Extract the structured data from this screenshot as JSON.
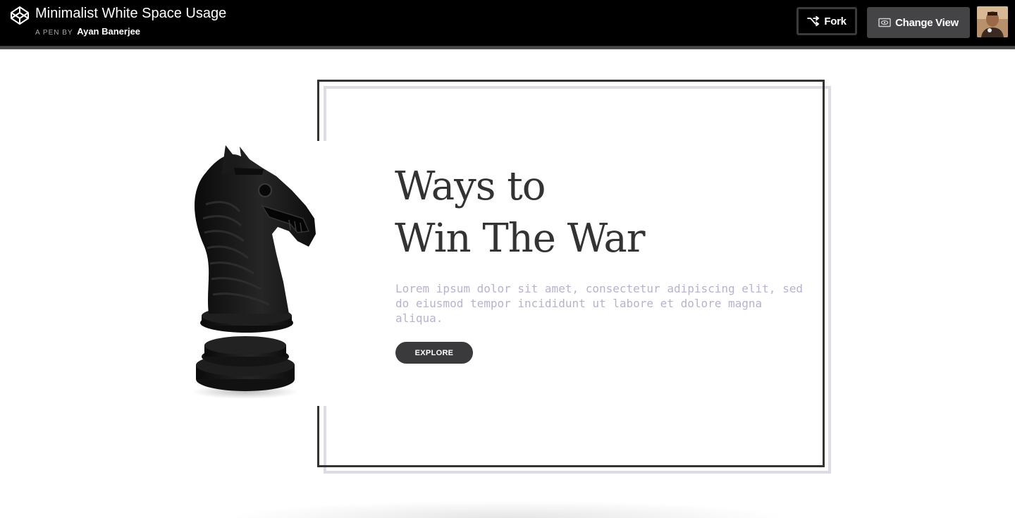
{
  "header": {
    "title": "Minimalist White Space Usage",
    "pen_by": "A PEN BY",
    "author": "Ayan Banerjee",
    "fork_label": "Fork",
    "change_view_label": "Change View"
  },
  "hero": {
    "heading_line1": "Ways to",
    "heading_line2": "Win The War",
    "body": "Lorem ipsum dolor sit amet, consectetur adipiscing elit, sed do eiusmod tempor incididunt ut labore et dolore magna aliqua.",
    "cta_label": "EXPLORE"
  },
  "colors": {
    "topbar_bg": "#000000",
    "heading": "#333333",
    "body_text": "#b5b3cf",
    "button_bg": "#3a3a3c",
    "frame_front": "#333333",
    "frame_back": "#dcdce4"
  },
  "icons": {
    "logo": "codepen-logo-icon",
    "fork": "fork-icon",
    "change_view": "eye-icon",
    "hero_image": "chess-knight-icon"
  }
}
